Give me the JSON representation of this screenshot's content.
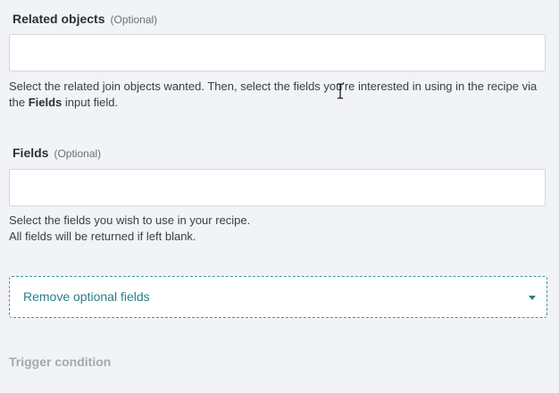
{
  "related_objects": {
    "label": "Related objects",
    "optional_tag": "(Optional)",
    "value": "",
    "placeholder": "",
    "help_text_before": "Select the related join objects wanted. Then, select the fields you're interested in using in the recipe via the ",
    "help_text_bold": "Fields",
    "help_text_after": " input field."
  },
  "fields": {
    "label": "Fields",
    "optional_tag": "(Optional)",
    "value": "",
    "placeholder": "",
    "help_line_1": "Select the fields you wish to use in your recipe.",
    "help_line_2": "All fields will be returned if left blank."
  },
  "optional_fields_toggle": {
    "label": "Remove optional fields",
    "icon": "caret-down-icon"
  },
  "trigger_condition": {
    "heading": "Trigger condition"
  },
  "pointer": {
    "icon": "text-cursor-icon"
  },
  "colors": {
    "accent": "#2a7f86",
    "dashed_border": "#3b9a96",
    "background": "#f1f3f6",
    "input_border": "#d3d8de",
    "muted_heading": "#a4a9ae"
  }
}
